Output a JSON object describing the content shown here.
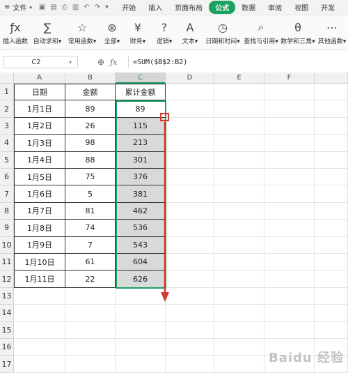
{
  "menubar": {
    "file_label": "文件",
    "tabs": [
      "开始",
      "插入",
      "页面布局",
      "公式",
      "数据",
      "审阅",
      "视图",
      "开发"
    ],
    "active_tab": "公式"
  },
  "ribbon": {
    "buttons": [
      {
        "label": "插入函数",
        "icon": "fx-icon",
        "glyph": "ƒx"
      },
      {
        "label": "自动求和▾",
        "icon": "sum-icon",
        "glyph": "∑"
      },
      {
        "label": "常用函数▾",
        "icon": "star-icon",
        "glyph": "☆"
      },
      {
        "label": "全部▾",
        "icon": "all-functions-icon",
        "glyph": "⊛"
      },
      {
        "label": "财务▾",
        "icon": "finance-icon",
        "glyph": "¥"
      },
      {
        "label": "逻辑▾",
        "icon": "logic-icon",
        "glyph": "?"
      },
      {
        "label": "文本▾",
        "icon": "text-icon",
        "glyph": "A"
      },
      {
        "label": "日期和时间▾",
        "icon": "clock-icon",
        "glyph": "◷"
      },
      {
        "label": "查找与引用▾",
        "icon": "lookup-icon",
        "glyph": "⌕"
      },
      {
        "label": "数学和三角▾",
        "icon": "math-icon",
        "glyph": "θ"
      },
      {
        "label": "其他函数▾",
        "icon": "more-icon",
        "glyph": "⋯"
      }
    ]
  },
  "formula_bar": {
    "name_box": "C2",
    "formula": "=SUM($B$2:B2)"
  },
  "columns": [
    "A",
    "B",
    "C",
    "D",
    "E",
    "F"
  ],
  "rows": [
    "1",
    "2",
    "3",
    "4",
    "5",
    "6",
    "7",
    "8",
    "9",
    "10",
    "11",
    "12",
    "13",
    "14",
    "15",
    "16",
    "17"
  ],
  "table": {
    "headers": [
      "日期",
      "金额",
      "累计金额"
    ],
    "data": [
      [
        "1月1日",
        "89",
        "89"
      ],
      [
        "1月2日",
        "26",
        "115"
      ],
      [
        "1月3日",
        "98",
        "213"
      ],
      [
        "1月4日",
        "88",
        "301"
      ],
      [
        "1月5日",
        "75",
        "376"
      ],
      [
        "1月6日",
        "5",
        "381"
      ],
      [
        "1月7日",
        "81",
        "462"
      ],
      [
        "1月8日",
        "74",
        "536"
      ],
      [
        "1月9日",
        "7",
        "543"
      ],
      [
        "1月10日",
        "61",
        "604"
      ],
      [
        "1月11日",
        "22",
        "626"
      ]
    ]
  },
  "watermark": "Baidu 经验",
  "colors": {
    "accent": "#1aa260",
    "annotation": "#d63a2f",
    "fill_gray": "#d9d9d9"
  }
}
